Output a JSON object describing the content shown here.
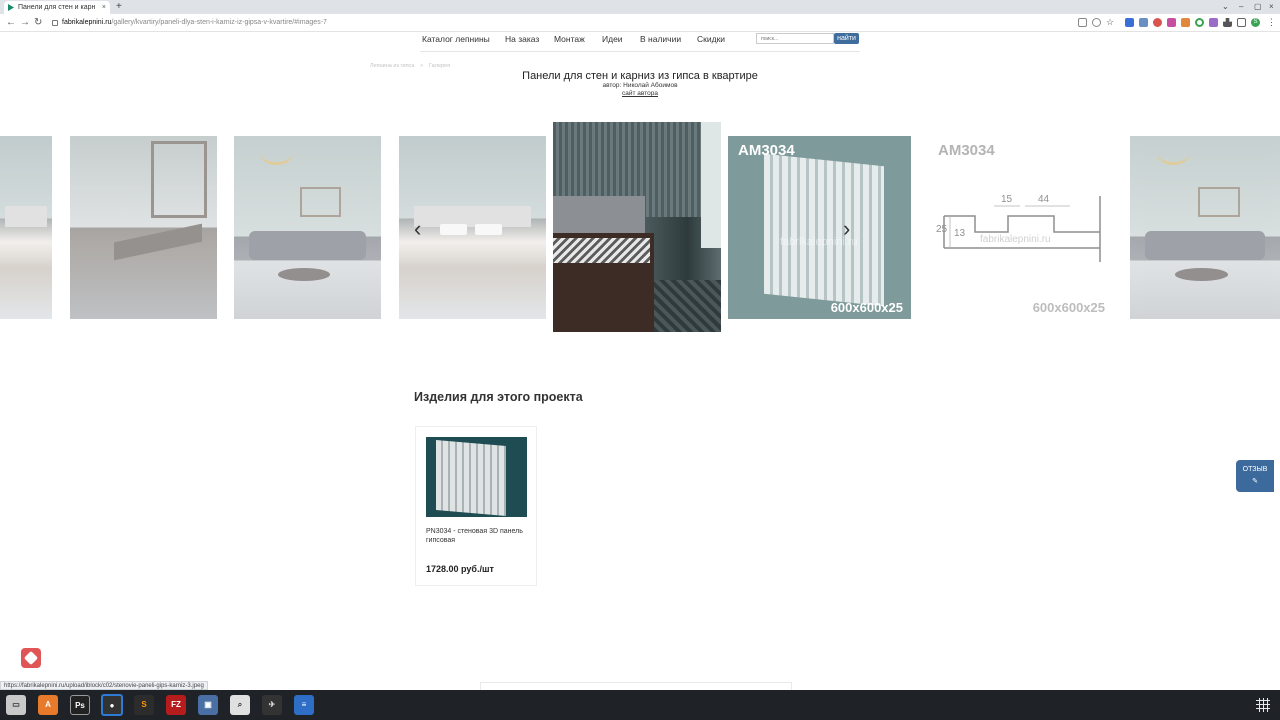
{
  "browser": {
    "tab_title": "Панели для стен и карн",
    "tab_close": "×",
    "new_tab": "+",
    "url_host": "fabrikalepnini.ru",
    "url_path": "/gallery/kvartiry/paneli-dlya-sten-i-karniz-iz-gipsa-v-kvartire/#images-7",
    "window_controls": [
      "⌄",
      "–",
      "▢",
      "×"
    ],
    "profile_initial": "S"
  },
  "site_nav": {
    "items": [
      "Каталог лепнины",
      "На заказ",
      "Монтаж",
      "Идеи",
      "В наличии",
      "Скидки"
    ],
    "search_placeholder": "поиск...",
    "search_button": "найти"
  },
  "breadcrumb": [
    "Лепнина из гипса",
    ">",
    "Галерея"
  ],
  "page": {
    "title": "Панели для стен и карниз из гипса в квартире",
    "author": "автор: Николай Абоимов",
    "author_link": "сайт автора"
  },
  "gallery": {
    "prev_arrow": "‹",
    "next_arrow": "›",
    "panel_label": "AM3034",
    "panel_size": "600x600x25",
    "watermark": "fabrikalepnini.ru",
    "drawing_label": "AM3034",
    "drawing_size": "600x600x25",
    "dimensions": [
      "15",
      "44",
      "25",
      "13"
    ]
  },
  "products": {
    "section_title": "Изделия для этого проекта",
    "items": [
      {
        "name": "PN3034 - стеновая 3D панель гипсовая",
        "price": "1728.00 руб./шт"
      }
    ]
  },
  "feedback": {
    "label": "ОТЗЫВ",
    "icon": "✎"
  },
  "status_url": "https://fabrikalepnini.ru/upload/iblock/c02/stenovie-paneli-gips-karniz-3.jpeg",
  "taskbar": {
    "apps": [
      "files",
      "store",
      "PS",
      "chrome",
      "sublime",
      "FZ",
      "app",
      "search",
      "tools",
      "docs"
    ]
  }
}
